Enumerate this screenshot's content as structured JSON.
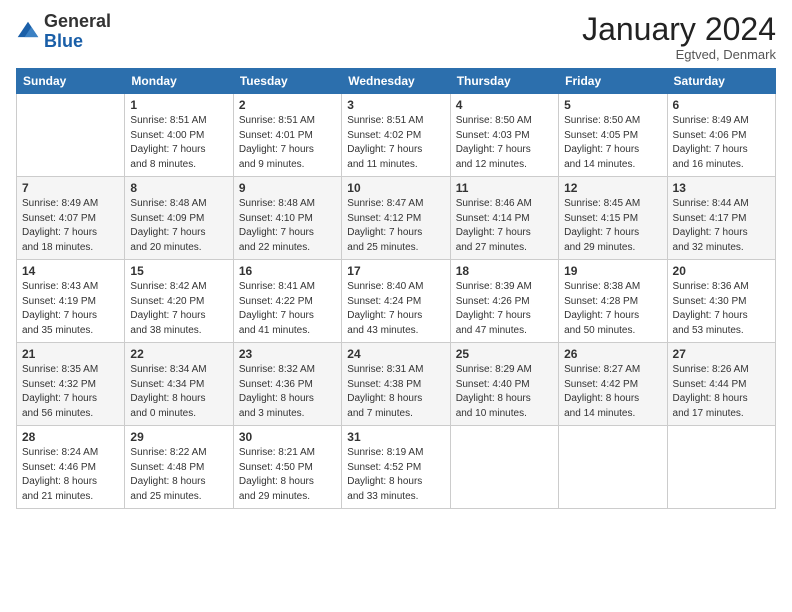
{
  "logo": {
    "general": "General",
    "blue": "Blue"
  },
  "header": {
    "month_year": "January 2024",
    "location": "Egtved, Denmark"
  },
  "weekdays": [
    "Sunday",
    "Monday",
    "Tuesday",
    "Wednesday",
    "Thursday",
    "Friday",
    "Saturday"
  ],
  "weeks": [
    [
      {
        "day": "",
        "info": ""
      },
      {
        "day": "1",
        "info": "Sunrise: 8:51 AM\nSunset: 4:00 PM\nDaylight: 7 hours\nand 8 minutes."
      },
      {
        "day": "2",
        "info": "Sunrise: 8:51 AM\nSunset: 4:01 PM\nDaylight: 7 hours\nand 9 minutes."
      },
      {
        "day": "3",
        "info": "Sunrise: 8:51 AM\nSunset: 4:02 PM\nDaylight: 7 hours\nand 11 minutes."
      },
      {
        "day": "4",
        "info": "Sunrise: 8:50 AM\nSunset: 4:03 PM\nDaylight: 7 hours\nand 12 minutes."
      },
      {
        "day": "5",
        "info": "Sunrise: 8:50 AM\nSunset: 4:05 PM\nDaylight: 7 hours\nand 14 minutes."
      },
      {
        "day": "6",
        "info": "Sunrise: 8:49 AM\nSunset: 4:06 PM\nDaylight: 7 hours\nand 16 minutes."
      }
    ],
    [
      {
        "day": "7",
        "info": "Sunrise: 8:49 AM\nSunset: 4:07 PM\nDaylight: 7 hours\nand 18 minutes."
      },
      {
        "day": "8",
        "info": "Sunrise: 8:48 AM\nSunset: 4:09 PM\nDaylight: 7 hours\nand 20 minutes."
      },
      {
        "day": "9",
        "info": "Sunrise: 8:48 AM\nSunset: 4:10 PM\nDaylight: 7 hours\nand 22 minutes."
      },
      {
        "day": "10",
        "info": "Sunrise: 8:47 AM\nSunset: 4:12 PM\nDaylight: 7 hours\nand 25 minutes."
      },
      {
        "day": "11",
        "info": "Sunrise: 8:46 AM\nSunset: 4:14 PM\nDaylight: 7 hours\nand 27 minutes."
      },
      {
        "day": "12",
        "info": "Sunrise: 8:45 AM\nSunset: 4:15 PM\nDaylight: 7 hours\nand 29 minutes."
      },
      {
        "day": "13",
        "info": "Sunrise: 8:44 AM\nSunset: 4:17 PM\nDaylight: 7 hours\nand 32 minutes."
      }
    ],
    [
      {
        "day": "14",
        "info": "Sunrise: 8:43 AM\nSunset: 4:19 PM\nDaylight: 7 hours\nand 35 minutes."
      },
      {
        "day": "15",
        "info": "Sunrise: 8:42 AM\nSunset: 4:20 PM\nDaylight: 7 hours\nand 38 minutes."
      },
      {
        "day": "16",
        "info": "Sunrise: 8:41 AM\nSunset: 4:22 PM\nDaylight: 7 hours\nand 41 minutes."
      },
      {
        "day": "17",
        "info": "Sunrise: 8:40 AM\nSunset: 4:24 PM\nDaylight: 7 hours\nand 43 minutes."
      },
      {
        "day": "18",
        "info": "Sunrise: 8:39 AM\nSunset: 4:26 PM\nDaylight: 7 hours\nand 47 minutes."
      },
      {
        "day": "19",
        "info": "Sunrise: 8:38 AM\nSunset: 4:28 PM\nDaylight: 7 hours\nand 50 minutes."
      },
      {
        "day": "20",
        "info": "Sunrise: 8:36 AM\nSunset: 4:30 PM\nDaylight: 7 hours\nand 53 minutes."
      }
    ],
    [
      {
        "day": "21",
        "info": "Sunrise: 8:35 AM\nSunset: 4:32 PM\nDaylight: 7 hours\nand 56 minutes."
      },
      {
        "day": "22",
        "info": "Sunrise: 8:34 AM\nSunset: 4:34 PM\nDaylight: 8 hours\nand 0 minutes."
      },
      {
        "day": "23",
        "info": "Sunrise: 8:32 AM\nSunset: 4:36 PM\nDaylight: 8 hours\nand 3 minutes."
      },
      {
        "day": "24",
        "info": "Sunrise: 8:31 AM\nSunset: 4:38 PM\nDaylight: 8 hours\nand 7 minutes."
      },
      {
        "day": "25",
        "info": "Sunrise: 8:29 AM\nSunset: 4:40 PM\nDaylight: 8 hours\nand 10 minutes."
      },
      {
        "day": "26",
        "info": "Sunrise: 8:27 AM\nSunset: 4:42 PM\nDaylight: 8 hours\nand 14 minutes."
      },
      {
        "day": "27",
        "info": "Sunrise: 8:26 AM\nSunset: 4:44 PM\nDaylight: 8 hours\nand 17 minutes."
      }
    ],
    [
      {
        "day": "28",
        "info": "Sunrise: 8:24 AM\nSunset: 4:46 PM\nDaylight: 8 hours\nand 21 minutes."
      },
      {
        "day": "29",
        "info": "Sunrise: 8:22 AM\nSunset: 4:48 PM\nDaylight: 8 hours\nand 25 minutes."
      },
      {
        "day": "30",
        "info": "Sunrise: 8:21 AM\nSunset: 4:50 PM\nDaylight: 8 hours\nand 29 minutes."
      },
      {
        "day": "31",
        "info": "Sunrise: 8:19 AM\nSunset: 4:52 PM\nDaylight: 8 hours\nand 33 minutes."
      },
      {
        "day": "",
        "info": ""
      },
      {
        "day": "",
        "info": ""
      },
      {
        "day": "",
        "info": ""
      }
    ]
  ]
}
